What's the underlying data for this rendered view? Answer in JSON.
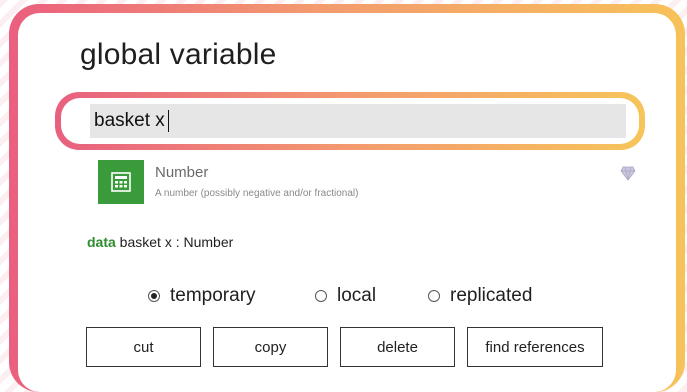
{
  "dialog": {
    "title": "global variable",
    "input_value": "basket x",
    "type_option": {
      "icon": "calculator-icon",
      "name": "Number",
      "description": "A number (possibly negative and/or fractional)",
      "badge_icon": "gem-icon"
    },
    "declaration": {
      "keyword": "data",
      "rest": " basket x : Number"
    },
    "scope_options": [
      {
        "label": "temporary",
        "selected": true
      },
      {
        "label": "local",
        "selected": false
      },
      {
        "label": "replicated",
        "selected": false
      }
    ],
    "buttons": {
      "cut": "cut",
      "copy": "copy",
      "delete": "delete",
      "find_references": "find references"
    }
  },
  "colors": {
    "frame_gradient_start": "#ea5f7e",
    "frame_gradient_end": "#f7c25a",
    "type_icon_bg": "#3a9b3a",
    "keyword": "#2e8b2e"
  }
}
